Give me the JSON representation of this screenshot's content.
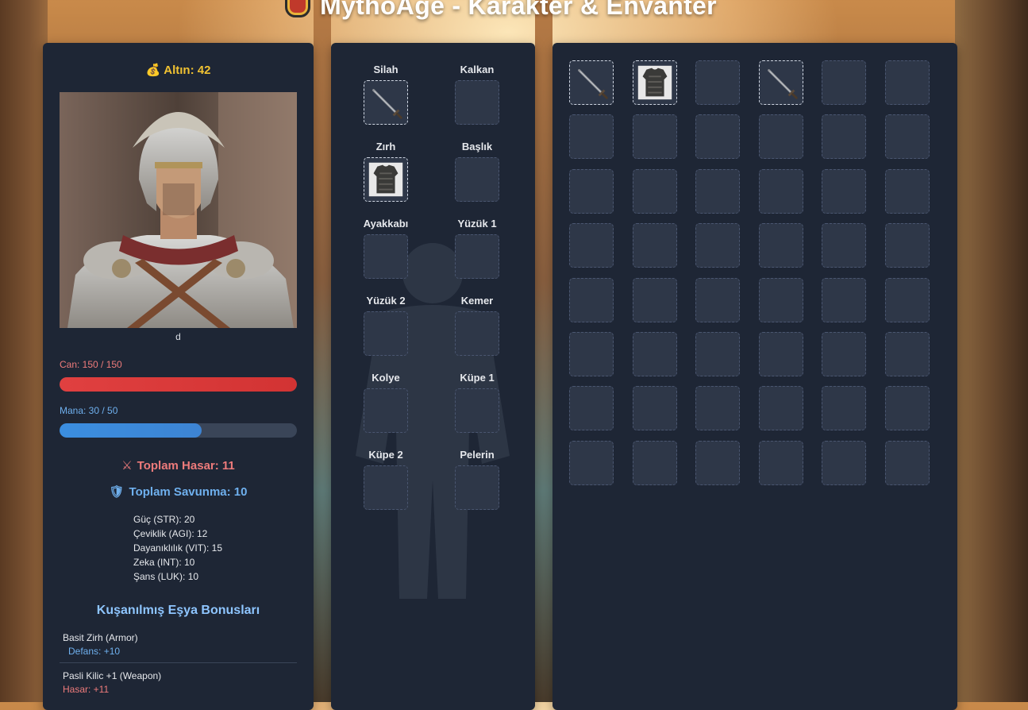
{
  "app": {
    "title": "MythoAge - Karakter & Envanter"
  },
  "character": {
    "gold_label": "Altın: 42",
    "name": "d",
    "hp_label": "Can: 150 / 150",
    "hp_fraction": 1.0,
    "mana_label": "Mana: 30 / 50",
    "mana_fraction": 0.6,
    "total_damage_label": "Toplam Hasar: 11",
    "total_defense_label": "Toplam Savunma: 10",
    "attributes": [
      "Güç (STR): 20",
      "Çeviklik (AGI): 12",
      "Dayanıklılık (VIT): 15",
      "Zeka (INT): 10",
      "Şans (LUK): 10"
    ]
  },
  "bonuses": {
    "title": "Kuşanılmış Eşya Bonusları",
    "items": [
      {
        "name": "Basit Zirh (Armor)",
        "effect": "Defans: +10"
      },
      {
        "name": "Pasli Kilic +1 (Weapon)",
        "effect": "Hasar: +11"
      }
    ]
  },
  "equipment": {
    "slots": [
      {
        "label": "Silah",
        "item_icon": "sword-icon"
      },
      {
        "label": "Kalkan",
        "item_icon": ""
      },
      {
        "label": "Zırh",
        "item_icon": "armor-icon"
      },
      {
        "label": "Başlık",
        "item_icon": ""
      },
      {
        "label": "Ayakkabı",
        "item_icon": ""
      },
      {
        "label": "Yüzük 1",
        "item_icon": ""
      },
      {
        "label": "Yüzük 2",
        "item_icon": ""
      },
      {
        "label": "Kemer",
        "item_icon": ""
      },
      {
        "label": "Kolye",
        "item_icon": ""
      },
      {
        "label": "Küpe 1",
        "item_icon": ""
      },
      {
        "label": "Küpe 2",
        "item_icon": ""
      },
      {
        "label": "Pelerin",
        "item_icon": ""
      }
    ]
  },
  "inventory": {
    "columns": 6,
    "rows": 8,
    "items": [
      {
        "slot": 0,
        "item_icon": "sword-icon"
      },
      {
        "slot": 1,
        "item_icon": "armor-icon"
      },
      {
        "slot": 3,
        "item_icon": "sword-icon"
      }
    ]
  },
  "colors": {
    "panel": "#1e2635",
    "slot": "#2e3748",
    "gold": "#f1c232",
    "hp": "#d23333",
    "mana": "#3d84d3",
    "damage_text": "#ee7b7b",
    "defense_text": "#6fb0ee",
    "bonus_title": "#8ec5ff"
  }
}
